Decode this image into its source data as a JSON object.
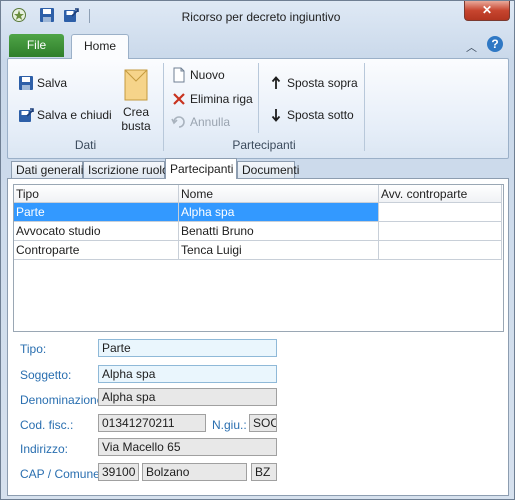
{
  "window": {
    "title": "Ricorso per decreto ingiuntivo",
    "close_label": "✕"
  },
  "ribbon": {
    "file_tab": "File",
    "home_tab": "Home",
    "dati": {
      "salva": "Salva",
      "salva_chiudi": "Salva e chiudi",
      "crea_busta_line1": "Crea",
      "crea_busta_line2": "busta",
      "group_label": "Dati"
    },
    "partecipanti": {
      "nuovo": "Nuovo",
      "elimina_riga": "Elimina riga",
      "annulla": "Annulla",
      "sposta_sopra": "Sposta sopra",
      "sposta_sotto": "Sposta sotto",
      "group_label": "Partecipanti"
    }
  },
  "tabs": [
    "Dati generali",
    "Iscrizione ruolo",
    "Partecipanti",
    "Documenti"
  ],
  "grid": {
    "columns": [
      "Tipo",
      "Nome",
      "Avv. controparte"
    ],
    "rows": [
      {
        "tipo": "Parte",
        "nome": "Alpha spa",
        "avv": ""
      },
      {
        "tipo": "Avvocato studio",
        "nome": "Benatti Bruno",
        "avv": ""
      },
      {
        "tipo": "Controparte",
        "nome": "Tenca Luigi",
        "avv": ""
      }
    ]
  },
  "form": {
    "tipo_label": "Tipo:",
    "tipo_value": "Parte",
    "soggetto_label": "Soggetto:",
    "soggetto_value": "Alpha spa",
    "denominazione_label": "Denominazione:",
    "denominazione_value": "Alpha spa",
    "codfisc_label": "Cod. fisc.:",
    "codfisc_value": "01341270211",
    "ngiu_label": "N.giu.:",
    "ngiu_value": "SOC",
    "indirizzo_label": "Indirizzo:",
    "indirizzo_value": "Via Macello 65",
    "cap_label": "CAP / Comune:",
    "cap_value": "39100",
    "comune_value": "Bolzano",
    "prov_value": "BZ"
  },
  "colors": {
    "accent": "#3399ff",
    "file_tab": "#3b8f36",
    "label_blue": "#2a6fb0",
    "editable_bg": "#eaf6fd"
  }
}
